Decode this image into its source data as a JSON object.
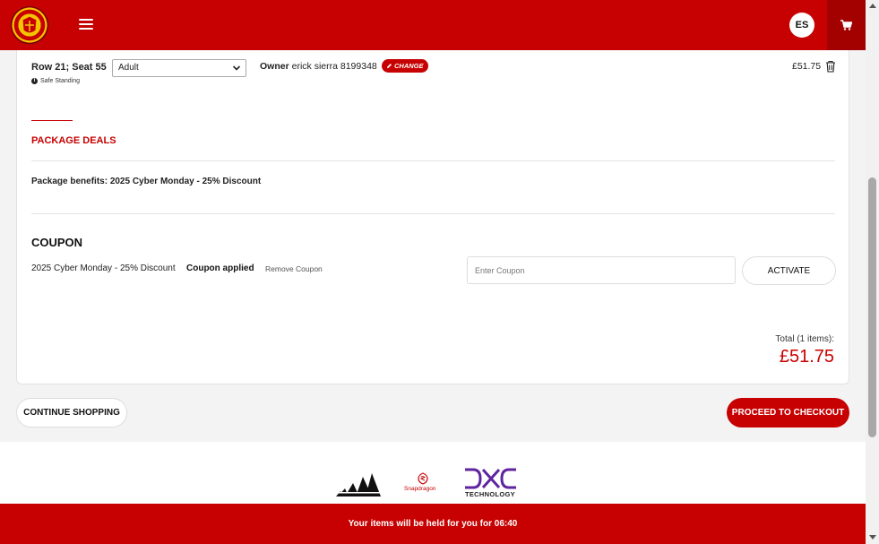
{
  "header": {
    "avatar_initials": "ES",
    "colors": {
      "primary": "#c70101",
      "cart_bg": "#a30000"
    }
  },
  "ticket": {
    "seat": "Row 21; Seat 55",
    "area": "Safe Standing",
    "ticket_type": "Adult",
    "owner_label": "Owner",
    "owner_value": "erick sierra 8199348",
    "change_label": "CHANGE",
    "price": "£51.75"
  },
  "package": {
    "title": "PACKAGE DEALS",
    "benefits": "Package benefits: 2025 Cyber Monday - 25% Discount"
  },
  "coupon": {
    "title": "COUPON",
    "name": "2025 Cyber Monday - 25% Discount",
    "status": "Coupon applied",
    "remove_label": "Remove Coupon",
    "input_placeholder": "Enter Coupon",
    "activate_label": "ACTIVATE"
  },
  "total": {
    "label": "Total (1 items):",
    "amount": "£51.75"
  },
  "actions": {
    "continue_label": "CONTINUE SHOPPING",
    "checkout_label": "PROCEED TO CHECKOUT"
  },
  "sponsors": {
    "snapdragon": "Snapdragon",
    "dxc_tagline": "TECHNOLOGY"
  },
  "hold_message": "Your items will be held for you for 06:40"
}
